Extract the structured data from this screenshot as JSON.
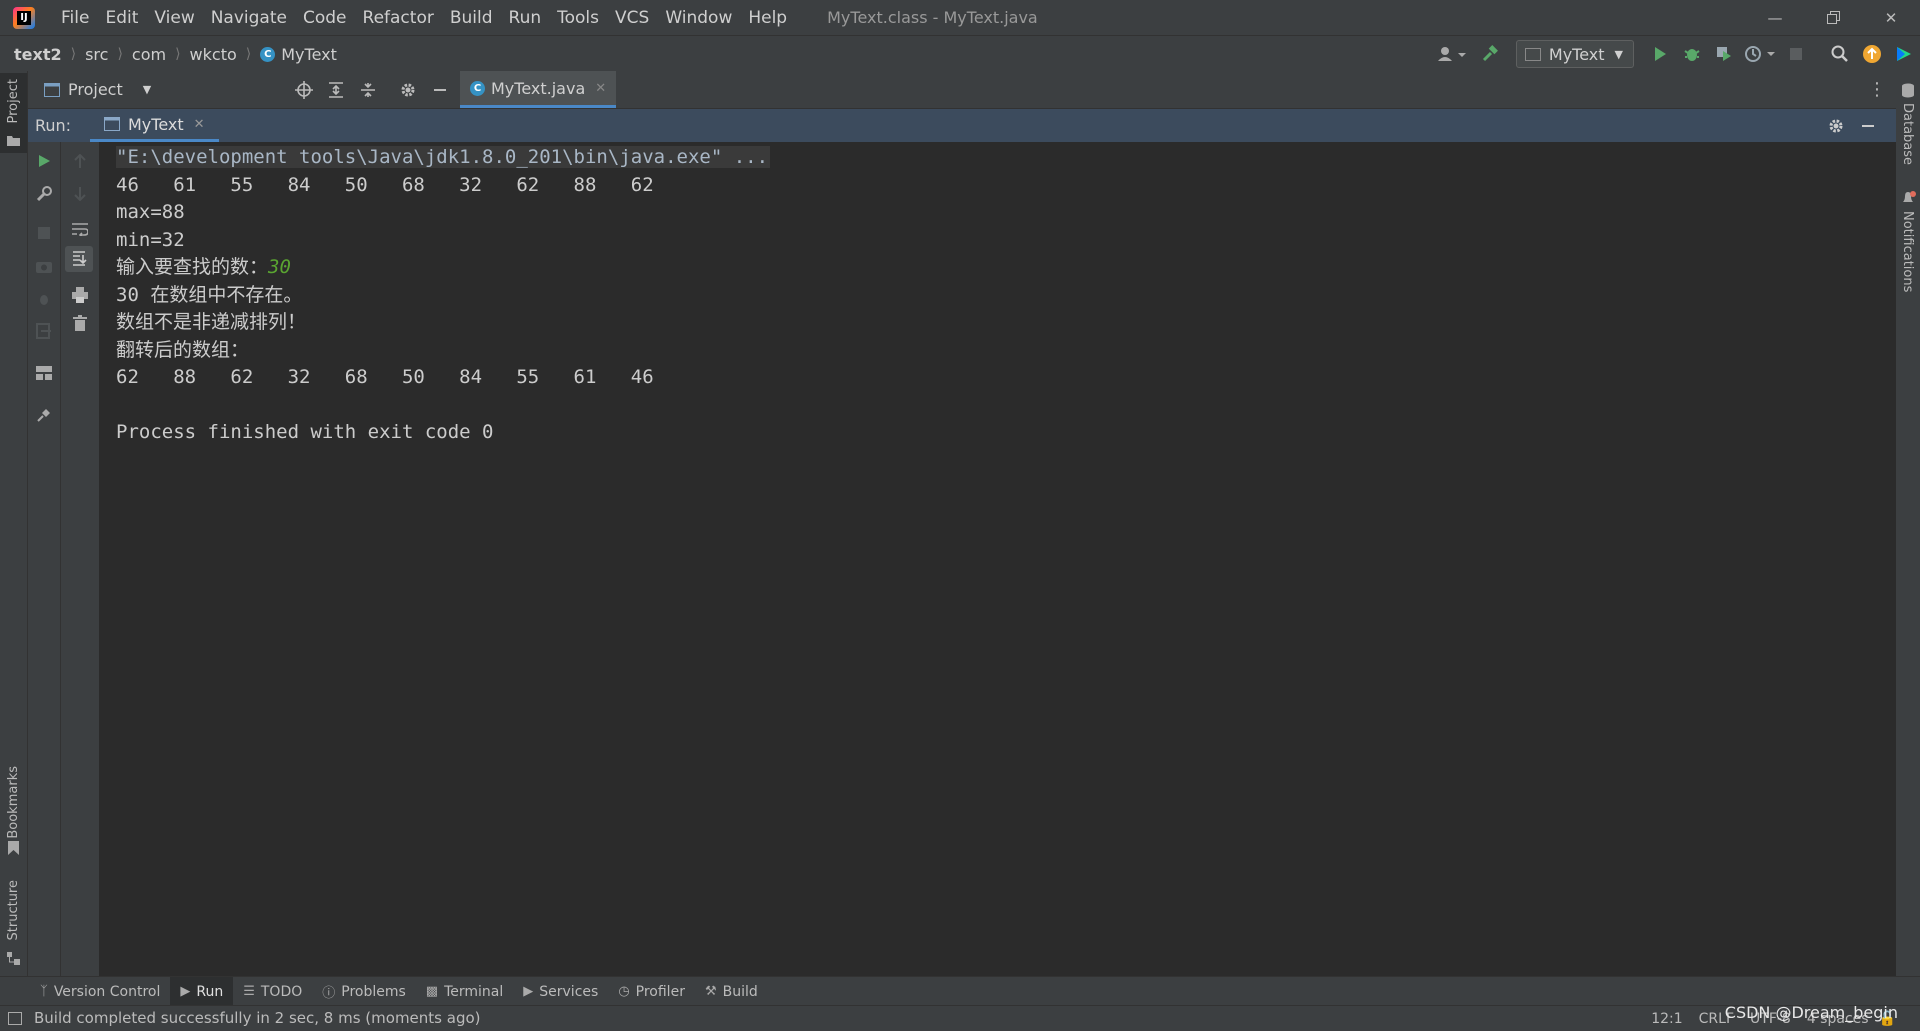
{
  "app": {
    "menu": [
      "File",
      "Edit",
      "View",
      "Navigate",
      "Code",
      "Refactor",
      "Build",
      "Run",
      "Tools",
      "VCS",
      "Window",
      "Help"
    ],
    "window_title": "MyText.class - MyText.java"
  },
  "breadcrumb": [
    "text2",
    "src",
    "com",
    "wkcto",
    "MyText"
  ],
  "toolbar": {
    "run_config": "MyText"
  },
  "project_panel": {
    "label": "Project",
    "editor_tab": "MyText.java"
  },
  "side_labels": {
    "left": [
      "Project",
      "Bookmarks",
      "Structure"
    ],
    "right": [
      "Database",
      "Notifications"
    ]
  },
  "run_window": {
    "label": "Run:",
    "tab": "MyText"
  },
  "console": {
    "cmd": "\"E:\\development tools\\Java\\jdk1.8.0_201\\bin\\java.exe\" ...",
    "array_line": "46   61   55   84   50   68   32   62   88   62",
    "max_line": "max=88",
    "min_line": "min=32",
    "prompt": "输入要查找的数：",
    "user_input": "30",
    "not_found": "30 在数组中不存在。",
    "not_sorted": "数组不是非递减排列！",
    "reversed_label": "翻转后的数组：",
    "reversed_line": "62   88   62   32   68   50   84   55   61   46",
    "exit_line": "Process finished with exit code 0"
  },
  "bottom_tools": [
    {
      "label": "Version Control"
    },
    {
      "label": "Run",
      "active": true
    },
    {
      "label": "TODO"
    },
    {
      "label": "Problems"
    },
    {
      "label": "Terminal"
    },
    {
      "label": "Services"
    },
    {
      "label": "Profiler"
    },
    {
      "label": "Build"
    }
  ],
  "status": {
    "message": "Build completed successfully in 2 sec, 8 ms (moments ago)",
    "position": "12:1",
    "line_sep": "CRLF",
    "encoding": "UTF-8",
    "indent": "4 spaces",
    "watermark": "CSDN @Dream_begin"
  },
  "colors": {
    "accent": "#4a88c7",
    "run_green": "#59a869",
    "input_green": "#5aa531"
  }
}
